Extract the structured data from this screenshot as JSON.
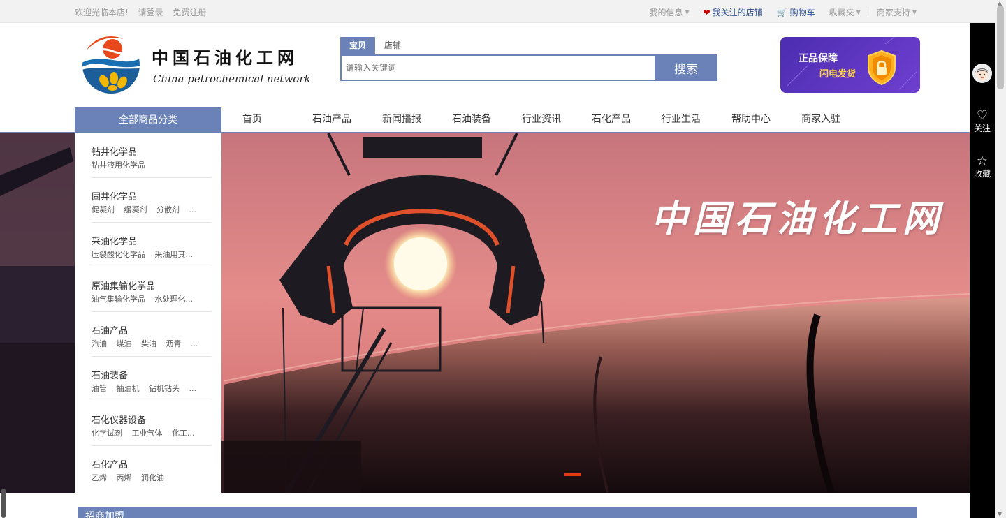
{
  "topbar": {
    "welcome": "欢迎光临本店!",
    "login": "请登录",
    "register": "免费注册",
    "my_info": "我的信息",
    "followed_shops": "我关注的店铺",
    "cart": "购物车",
    "favorites": "收藏夹",
    "merchant_support": "商家支持"
  },
  "header": {
    "logo_cn": "中国石油化工网",
    "logo_en": "China petrochemical network"
  },
  "search": {
    "tabs": [
      "宝贝",
      "店铺"
    ],
    "placeholder": "请输入关键词",
    "button": "搜索"
  },
  "promo": {
    "line1": "正品保障",
    "line2": "闪电发货"
  },
  "nav": {
    "all_categories": "全部商品分类",
    "items": [
      "首页",
      "石油产品",
      "新闻播报",
      "石油装备",
      "行业资讯",
      "石化产品",
      "行业生活",
      "帮助中心",
      "商家入驻"
    ]
  },
  "categories": [
    {
      "title": "钻井化学品",
      "subs": [
        "钻井液用化学品"
      ]
    },
    {
      "title": "固井化学品",
      "subs": [
        "促凝剂",
        "缓凝剂",
        "分散剂",
        "..."
      ]
    },
    {
      "title": "采油化学品",
      "subs": [
        "压裂酸化化学品",
        "采油用其..."
      ]
    },
    {
      "title": "原油集输化学品",
      "subs": [
        "油气集输化学品",
        "水处理化..."
      ]
    },
    {
      "title": "石油产品",
      "subs": [
        "汽油",
        "煤油",
        "柴油",
        "沥青",
        "..."
      ]
    },
    {
      "title": "石油装备",
      "subs": [
        "油管",
        "抽油机",
        "钻机钻头",
        "..."
      ]
    },
    {
      "title": "石化仪器设备",
      "subs": [
        "化学试剂",
        "工业气体",
        "化工..."
      ]
    },
    {
      "title": "石化产品",
      "subs": [
        "乙烯",
        "丙烯",
        "润化油"
      ]
    }
  ],
  "banner": {
    "slogan": "中国石油化工网"
  },
  "right_bar": {
    "follow": "关注",
    "collect": "收藏"
  },
  "bottom": {
    "title": "招商加盟"
  },
  "colors": {
    "accent": "#6a82b8",
    "promo_bg": "#5a35c0",
    "slide_dot": "#e23b12"
  }
}
